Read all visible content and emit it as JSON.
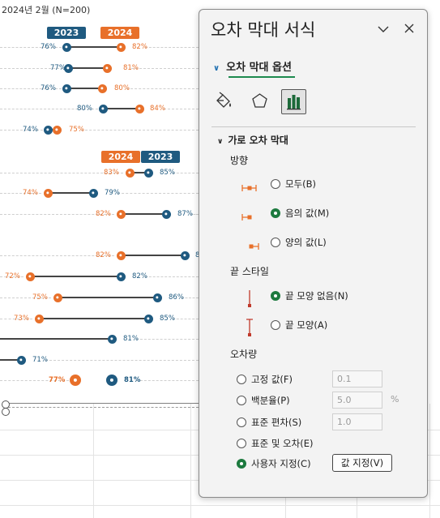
{
  "sheet": {
    "subtitle": "2024년 2월 (N=200)",
    "legend_top": {
      "first": "2023",
      "second": "2024"
    },
    "legend_mid": {
      "first": "2024",
      "second": "2023"
    },
    "colors": {
      "blue": "#1f5a80",
      "orange": "#e8702a"
    },
    "rows_top": [
      {
        "blue": "76%",
        "orange": "82%"
      },
      {
        "blue": "77%",
        "orange": "81%"
      },
      {
        "blue": "76%",
        "orange": "80%"
      },
      {
        "blue": "80%",
        "orange": "84%"
      },
      {
        "blue": "74%",
        "orange": "75%"
      }
    ],
    "rows_bottom": [
      {
        "orange": "83%",
        "blue": "85%"
      },
      {
        "orange": "74%",
        "blue": "79%"
      },
      {
        "orange": "82%",
        "blue": "87%"
      },
      {
        "orange": "82%",
        "blue": "8"
      },
      {
        "orange": "72%",
        "blue": "82%"
      },
      {
        "orange": "75%",
        "blue": "86%"
      },
      {
        "orange": "73%",
        "blue": "85%"
      },
      {
        "orange": "",
        "blue": "81%"
      },
      {
        "orange": "",
        "blue": "71%"
      },
      {
        "orange": "77%",
        "blue": "81%"
      }
    ]
  },
  "pane": {
    "title": "오차 막대 서식",
    "section_tab": "오차 막대 옵션",
    "icons": [
      "fill-line-icon",
      "effects-icon",
      "bar-chart-options-icon"
    ],
    "group": "가로 오차 막대",
    "direction_label": "방향",
    "direction": {
      "both": "모두(B)",
      "minus": "음의 값(M)",
      "plus": "양의 값(L)",
      "selected": "minus"
    },
    "end_style_label": "끝 스타일",
    "end_style": {
      "no_cap": "끝 모양 없음(N)",
      "cap": "끝 모양(A)",
      "selected": "no_cap"
    },
    "amount_label": "오차량",
    "amount": {
      "fixed": "고정 값(F)",
      "fixed_value": "0.1",
      "percent": "백분율(P)",
      "percent_value": "5.0",
      "percent_unit": "%",
      "stdev": "표준 편차(S)",
      "stdev_value": "1.0",
      "sterr": "표준 및 오차(E)",
      "custom": "사용자 지정(C)",
      "selected": "custom",
      "specify_button": "값 지정(V)"
    }
  }
}
